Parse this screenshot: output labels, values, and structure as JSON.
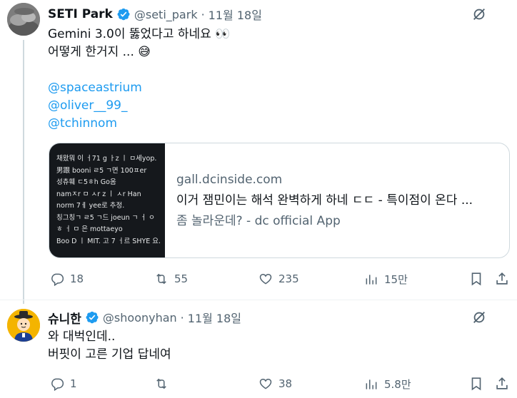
{
  "tweet1": {
    "display_name": "SETI Park",
    "handle": "@seti_park",
    "separator": "·",
    "date": "11월 18일",
    "lines": [
      "Gemini 3.0이 뚫었다고 하네요 👀",
      "어떻게 한거지 ... 😅"
    ],
    "mentions": [
      "@spaceastrium",
      "@oliver__99_",
      "@tchinnom"
    ],
    "card": {
      "image_lines": [
        "채왔뭐 이 ㅓ71 g ㅏz ㅣ ㅁ세yop.",
        "男跟 booni ㄹ5 ㄱ면 100ㅍer",
        "성츄훼 ㄷ5ㅎh Go옴",
        "namㅈr ㅁ ㅅr z ㅣ ㅅr Han",
        "norm 7ㅔ yee로 추정.",
        "칭그칭ㄱ ㄹ5 ㄱ드 joeun ㄱ ㅓ ㅇ",
        "ㅎ ㅓ ㅁ 은 mottaeyo",
        "Boo D ㅣ MIT. 고 7 ㅓ르 SHYE 요."
      ],
      "domain": "gall.dcinside.com",
      "title": "이거 잼민이는 해석 완벽하게 하네 ㄷㄷ - 특이점이 온다 ...",
      "description": "좀 놀라운데? - dc official App"
    },
    "actions": {
      "replies": "18",
      "reposts": "55",
      "likes": "235",
      "views": "15만"
    }
  },
  "tweet2": {
    "display_name": "슈니한",
    "handle": "@shoonyhan",
    "separator": "·",
    "date": "11월 18일",
    "lines": [
      "와 대벅인데..",
      "버핏이 고른 기업 답네여"
    ],
    "actions": {
      "replies": "1",
      "reposts": "",
      "likes": "38",
      "views": "5.8만"
    }
  },
  "colors": {
    "accent": "#1d9bf0",
    "text": "#0f1419",
    "muted": "#536471",
    "border": "#cfd9de",
    "thread_line": "#cfd9de"
  },
  "icons": [
    "verified-badge-icon",
    "grok-icon",
    "reply-icon",
    "repost-icon",
    "like-icon",
    "views-icon",
    "bookmark-icon",
    "share-icon"
  ]
}
